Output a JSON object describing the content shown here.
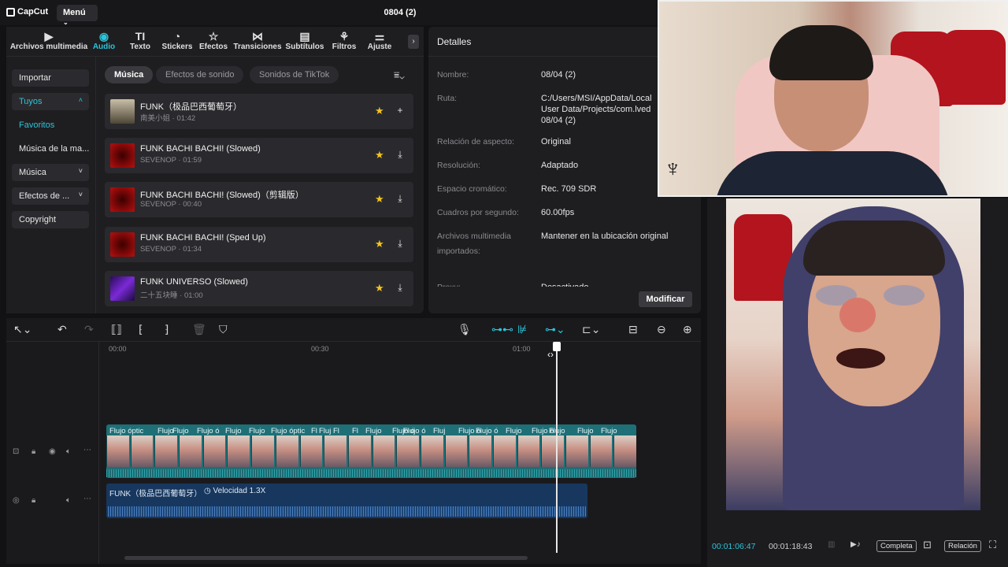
{
  "app": {
    "logo": "CapCut",
    "menu_label": "Menú",
    "project_title": "0804 (2)"
  },
  "tabs": [
    {
      "label": "Archivos multimedia",
      "icon": "media-icon"
    },
    {
      "label": "Audio",
      "icon": "audio-icon"
    },
    {
      "label": "Texto",
      "icon": "text-icon"
    },
    {
      "label": "Stickers",
      "icon": "sticker-icon"
    },
    {
      "label": "Efectos",
      "icon": "effects-icon"
    },
    {
      "label": "Transiciones",
      "icon": "transitions-icon"
    },
    {
      "label": "Subtítulos",
      "icon": "subtitles-icon"
    },
    {
      "label": "Filtros",
      "icon": "filters-icon"
    },
    {
      "label": "Ajuste",
      "icon": "adjust-icon"
    }
  ],
  "sidebar": {
    "importar": "Importar",
    "tuyos": "Tuyos",
    "favoritos": "Favoritos",
    "musica_marca": "Música de la ma...",
    "musica": "Música",
    "efectos": "Efectos de ...",
    "copyright": "Copyright"
  },
  "filters": {
    "musica": "Música",
    "efectos": "Efectos de sonido",
    "tiktok": "Sonidos de TikTok"
  },
  "tracks": [
    {
      "title": "FUNK（极品巴西葡萄牙）",
      "subtitle": "南美小姐 · 01:42",
      "action": "+"
    },
    {
      "title": "FUNK BACHI BACHI! (Slowed)",
      "subtitle": "SEVENOP · 01:59",
      "action": "⤓"
    },
    {
      "title": "FUNK BACHI BACHI! (Slowed)（剪辑版）",
      "subtitle": "SEVENOP · 00:40",
      "action": "⤓"
    },
    {
      "title": "FUNK BACHI BACHI! (Sped Up)",
      "subtitle": "SEVENOP · 01:34",
      "action": "⤓"
    },
    {
      "title": "FUNK UNIVERSO (Slowed)",
      "subtitle": "二十五块睡 · 01:00",
      "action": "⤓"
    }
  ],
  "details": {
    "header": "Detalles",
    "nombre_label": "Nombre:",
    "nombre": "08/04 (2)",
    "ruta_label": "Ruta:",
    "ruta": "C:/Users/MSI/AppData/Local User Data/Projects/com.lved 08/04 (2)",
    "aspecto_label": "Relación de aspecto:",
    "aspecto": "Original",
    "resolucion_label": "Resolución:",
    "resolucion": "Adaptado",
    "espacio_label": "Espacio cromático:",
    "espacio": "Rec. 709 SDR",
    "cuadros_label": "Cuadros por segundo:",
    "cuadros": "60.00fps",
    "importados_label": "Archivos multimedia importados:",
    "importados": "Mantener en la ubicación original",
    "partial_label": "Proxy:",
    "partial_value": "Desactivado",
    "modify": "Modificar"
  },
  "timeline": {
    "ticks": [
      "00:00",
      "00:30",
      "01:00"
    ],
    "clip_labels": [
      "Flujo óptic",
      "Flujo",
      "Flujo",
      "Flujo ó",
      "Flujo",
      "Flujo",
      "Flujo óptic",
      "Fl",
      "Fluj",
      "Fl",
      "Fl",
      "Flujo",
      "Flujo ó",
      "Flujo ó",
      "Fluj",
      "Flujo ó",
      "Flujo ó",
      "Flujo",
      "Flujo ó",
      "Flujo",
      "Flujo",
      "Flujo"
    ],
    "audio_name": "FUNK（极品巴西葡萄牙）",
    "audio_speed": "Velocidad 1.3X"
  },
  "player": {
    "current": "00:01:06:47",
    "total": "00:01:18:43",
    "full": "Completa",
    "ratio": "Relación"
  },
  "colors": {
    "accent": "#2bc4d8",
    "video_clip": "#1f6f77",
    "audio_clip": "#17375e",
    "star": "#f5c518"
  }
}
